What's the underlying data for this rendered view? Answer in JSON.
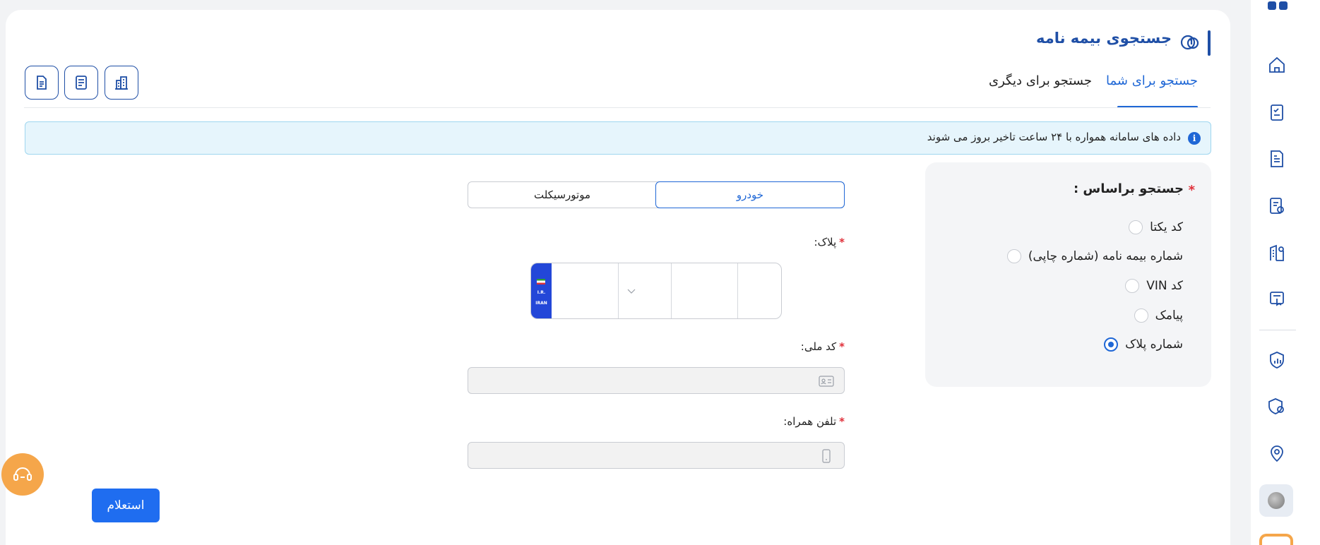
{
  "header": {
    "title": "جستجوی بیمه نامه",
    "icon": "policy-search-icon"
  },
  "tabs": [
    {
      "label": "جستجو برای شما",
      "active": true
    },
    {
      "label": "جستجو برای دیگری",
      "active": false
    }
  ],
  "top_buttons": [
    "building-icon",
    "form-icon",
    "document-icon"
  ],
  "info": {
    "text": "داده های سامانه همواره با ۲۴ ساعت تاخیر بروز می شوند",
    "icon_glyph": "i"
  },
  "search_by": {
    "title": "جستجو براساس :",
    "options": [
      {
        "label": "کد یکتا",
        "selected": false
      },
      {
        "label": "شماره بیمه نامه (شماره چاپی)",
        "selected": false
      },
      {
        "label": "کد VIN",
        "selected": false
      },
      {
        "label": "پیامک",
        "selected": false
      },
      {
        "label": "شماره پلاک",
        "selected": true
      }
    ]
  },
  "vehicle_type": {
    "car": "خودرو",
    "motorcycle": "موتورسیکلت",
    "selected": "car"
  },
  "form": {
    "plate_label": "پلاک:",
    "plate_flag_line1": "I.R.",
    "plate_flag_line2": "IRAN",
    "national_code_label": "کد ملی:",
    "national_code_value": "",
    "mobile_label": "تلفن همراه:",
    "mobile_value": "",
    "required_mark": "*"
  },
  "submit_label": "استعلام",
  "colors": {
    "primary": "#1f4fa6",
    "accent": "#1f67d6",
    "button": "#1f6df0",
    "help": "#f5a64a",
    "required": "#e0303a"
  },
  "sidebar": {
    "icons": [
      "home-icon",
      "checklist-icon",
      "report-icon",
      "certificate-icon",
      "building-badge-icon",
      "shield-document-icon",
      "shield-chart-icon",
      "shield-settings-icon",
      "location-icon"
    ]
  }
}
